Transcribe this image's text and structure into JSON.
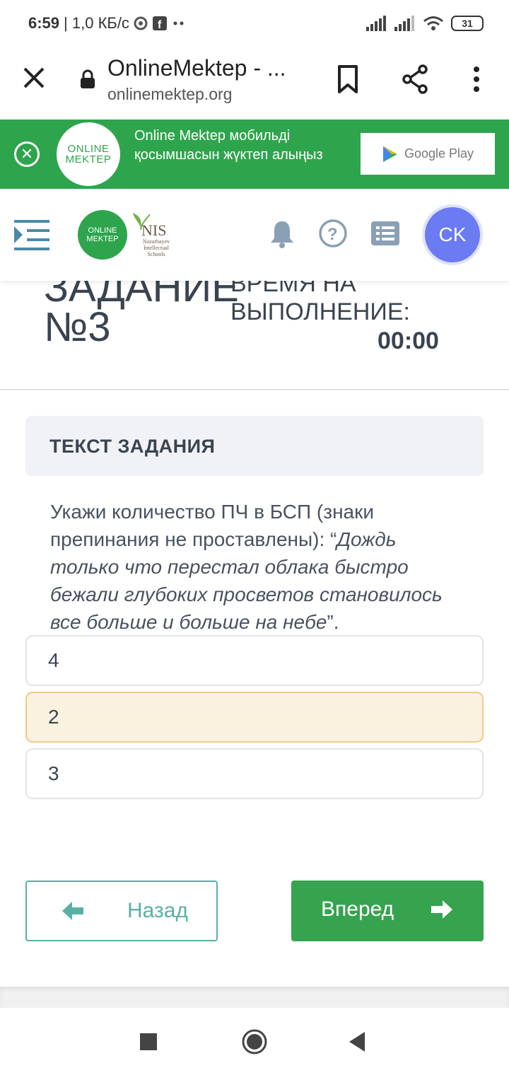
{
  "status_bar": {
    "time": "6:59",
    "net_speed": "| 1,0 КБ/с",
    "battery": "31"
  },
  "browser": {
    "title": "OnlineMektep - ...",
    "host": "onlinemektep.org"
  },
  "banner": {
    "logo_line1": "ONLINE",
    "logo_line2": "MEKTEP",
    "text": "Online Mektep мобильді қосымшасын жүктеп алыңыз",
    "store_label": "Google Play"
  },
  "header": {
    "logo_line1": "ONLINE",
    "logo_line2": "MEKTEP",
    "nis_title": "NIS",
    "nis_subtitle": "Nazarbayev Intellectual Schools",
    "avatar_initials": "CK"
  },
  "task": {
    "title": "ЗАДАНИЕ №3",
    "time_label": "ВРЕМЯ НА ВЫПОЛНЕНИЕ:",
    "time_value": "00:00",
    "section_label": "ТЕКСТ ЗАДАНИЯ",
    "question_plain": "Укажи количество ПЧ в БСП (знаки препинания не проставлены): “",
    "question_italic": "Дождь только что перестал облака быстро бежали глубоких просветов становилось все больше и больше на небе",
    "question_end": "”."
  },
  "answers": [
    {
      "label": "4",
      "selected": false
    },
    {
      "label": "2",
      "selected": true
    },
    {
      "label": "3",
      "selected": false
    }
  ],
  "buttons": {
    "back": "Назад",
    "next": "Вперед"
  },
  "colors": {
    "brand_green": "#2ea54d",
    "button_green": "#36a34f",
    "teal": "#5ab0a6",
    "avatar": "#6b7bf2",
    "selected_bg": "#fbf1df"
  }
}
